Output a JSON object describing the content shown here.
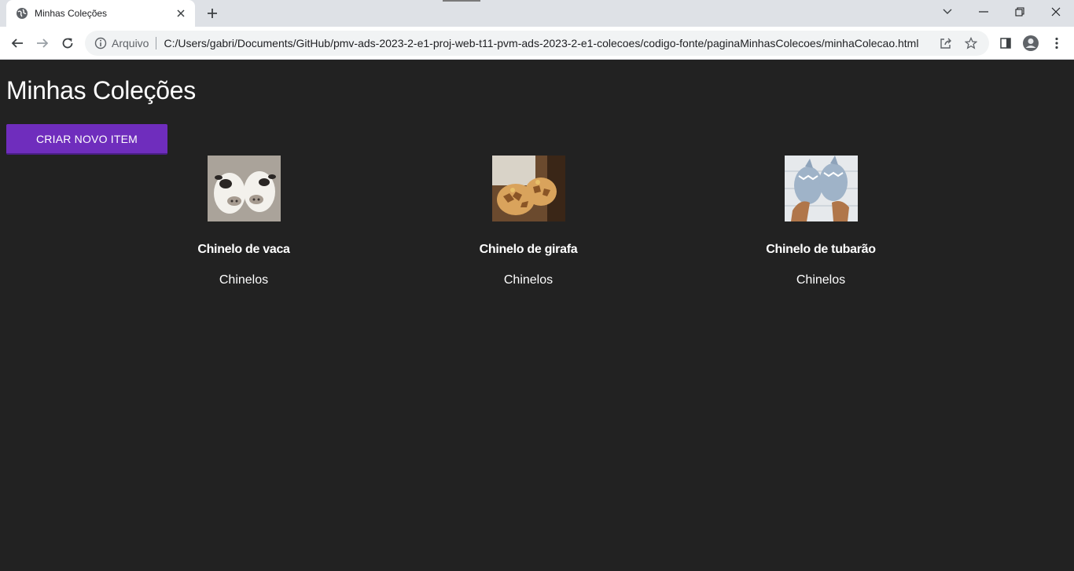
{
  "browser": {
    "tab_title": "Minhas Coleções",
    "address_scheme": "Arquivo",
    "url": "C:/Users/gabri/Documents/GitHub/pmv-ads-2023-2-e1-proj-web-t11-pvm-ads-2023-2-e1-colecoes/codigo-fonte/paginaMinhasColecoes/minhaColecao.html"
  },
  "page": {
    "title": "Minhas Coleções",
    "create_button": "CRIAR NOVO ITEM"
  },
  "items": [
    {
      "name": "Chinelo de vaca",
      "category": "Chinelos",
      "image": "cow-slippers"
    },
    {
      "name": "Chinelo de girafa",
      "category": "Chinelos",
      "image": "giraffe-slippers"
    },
    {
      "name": "Chinelo de tubarão",
      "category": "Chinelos",
      "image": "shark-slippers"
    }
  ],
  "colors": {
    "page_background": "#222222",
    "button_purple": "#6f2dbd",
    "text": "#ffffff"
  }
}
